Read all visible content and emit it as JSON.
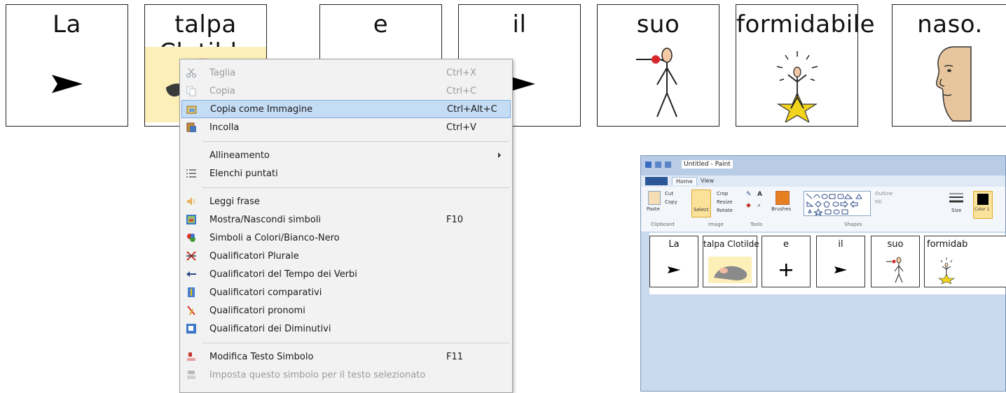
{
  "cards": [
    {
      "word": "La",
      "symbol": "triangle-arrow-icon"
    },
    {
      "word": "talpa Clotilde",
      "symbol": "mole-picture"
    },
    {
      "word": "e",
      "symbol": "plus-icon"
    },
    {
      "word": "il",
      "symbol": "triangle-arrow-icon"
    },
    {
      "word": "suo",
      "symbol": "person-pointing-icon"
    },
    {
      "word": "formidabile",
      "symbol": "person-star-icon"
    },
    {
      "word": "naso.",
      "symbol": "face-nose-icon"
    }
  ],
  "context_menu": {
    "items": [
      {
        "label": "Taglia",
        "shortcut": "Ctrl+X",
        "icon": "scissors-icon",
        "disabled": true
      },
      {
        "label": "Copia",
        "shortcut": "Ctrl+C",
        "icon": "copy-icon",
        "disabled": true
      },
      {
        "label": "Copia come Immagine",
        "shortcut": "Ctrl+Alt+C",
        "icon": "copy-image-icon",
        "highlighted": true
      },
      {
        "label": "Incolla",
        "shortcut": "Ctrl+V",
        "icon": "paste-icon"
      },
      {
        "label": "Allineamento",
        "shortcut": "",
        "icon": "",
        "submenu": true
      },
      {
        "label": "Elenchi puntati",
        "shortcut": "",
        "icon": "bullet-list-icon"
      },
      {
        "label": "Leggi frase",
        "shortcut": "",
        "icon": "speaker-icon"
      },
      {
        "label": "Mostra/Nascondi simboli",
        "shortcut": "F10",
        "icon": "show-symbols-icon"
      },
      {
        "label": "Simboli a Colori/Bianco-Nero",
        "shortcut": "",
        "icon": "color-symbols-icon"
      },
      {
        "label": "Qualificatori Plurale",
        "shortcut": "",
        "icon": "plural-icon"
      },
      {
        "label": "Qualificatori del Tempo dei Verbi",
        "shortcut": "",
        "icon": "verb-tense-icon"
      },
      {
        "label": "Qualificatori comparativi",
        "shortcut": "",
        "icon": "comparative-icon"
      },
      {
        "label": "Qualificatori pronomi",
        "shortcut": "",
        "icon": "pronoun-icon"
      },
      {
        "label": "Qualificatori dei Diminutivi",
        "shortcut": "",
        "icon": "diminutive-icon"
      },
      {
        "label": "Modifica Testo Simbolo",
        "shortcut": "F11",
        "icon": "edit-symbol-text-icon"
      },
      {
        "label": "Imposta questo simbolo per il testo selezionato",
        "shortcut": "",
        "icon": "set-symbol-icon",
        "disabled": true
      }
    ]
  },
  "paint": {
    "title": "Untitled - Paint",
    "tabs": {
      "file": "",
      "home": "Home",
      "view": "View"
    },
    "ribbon": {
      "paste": "Paste",
      "cut": "Cut",
      "copy": "Copy",
      "clipboard_group": "Clipboard",
      "select": "Select",
      "crop": "Crop",
      "resize": "Resize",
      "rotate": "Rotate",
      "image_group": "Image",
      "tools_group": "Tools",
      "brushes": "Brushes",
      "outline": "Outline",
      "fill": "Fill",
      "shapes_group": "Shapes",
      "size": "Size",
      "color1": "Color 1"
    },
    "cards": [
      {
        "word": "La"
      },
      {
        "word": "talpa Clotilde"
      },
      {
        "word": "e"
      },
      {
        "word": "il"
      },
      {
        "word": "suo"
      },
      {
        "word": "formidab"
      }
    ]
  }
}
